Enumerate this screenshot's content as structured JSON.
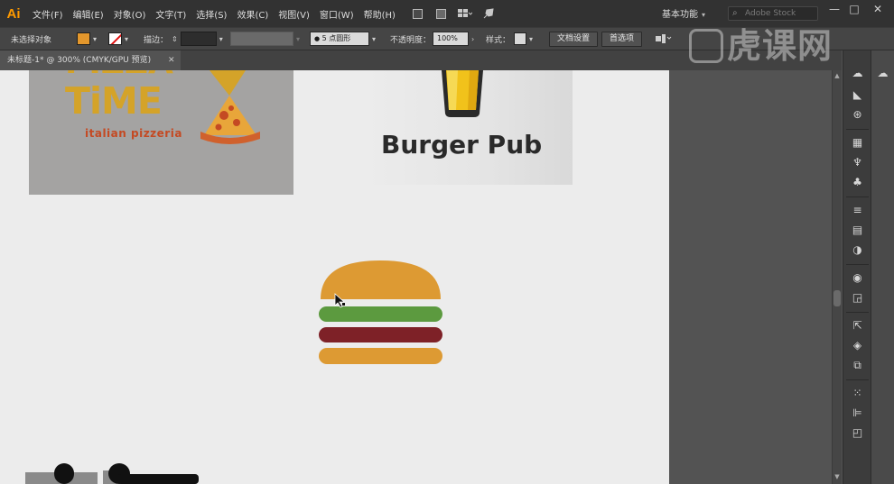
{
  "app": {
    "logo": "Ai"
  },
  "menu": [
    "文件(F)",
    "编辑(E)",
    "对象(O)",
    "文字(T)",
    "选择(S)",
    "效果(C)",
    "视图(V)",
    "窗口(W)",
    "帮助(H)"
  ],
  "menubar_icons": [
    "bridge-icon",
    "stock-icon",
    "arrange-documents-icon",
    "gpu-rocket-icon"
  ],
  "workspace": {
    "label": "基本功能"
  },
  "stock_search": {
    "placeholder": "Adobe Stock"
  },
  "window_controls": [
    "—",
    "□",
    "✕"
  ],
  "control": {
    "selection": "未选择对象",
    "fill_color": "#e3972c",
    "stroke_label": "描边：",
    "brush": "5 点圆形",
    "opacity_label": "不透明度：",
    "opacity_value": "100%",
    "style_label": "样式：",
    "doc_setup_button": "文档设置",
    "prefs_button": "首选项"
  },
  "document_tab": {
    "title": "未标题-1* @ 300% (CMYK/GPU 预览)"
  },
  "artwork": {
    "pizza": {
      "title": "TiME",
      "subtitle": "italian pizzeria",
      "title_color": "#d4a329",
      "sub_color": "#c44a23"
    },
    "pub": {
      "title": "Burger Pub"
    },
    "burger_colors": {
      "bun": "#dd9a33",
      "lettuce": "#5c9a3f",
      "patty": "#7e2127"
    }
  },
  "panels": [
    "libraries-icon",
    "properties-icon",
    "color-guide-icon",
    "swatches-icon",
    "brushes-icon",
    "symbols-icon",
    "stroke-icon",
    "gradient-icon",
    "transparency-icon",
    "appearance-icon",
    "graphic-styles-icon",
    "export-icon",
    "layers-icon",
    "artboards-icon",
    "transform-icon",
    "align-icon",
    "pathfinder-icon"
  ],
  "watermark": {
    "text": "虎课网"
  }
}
